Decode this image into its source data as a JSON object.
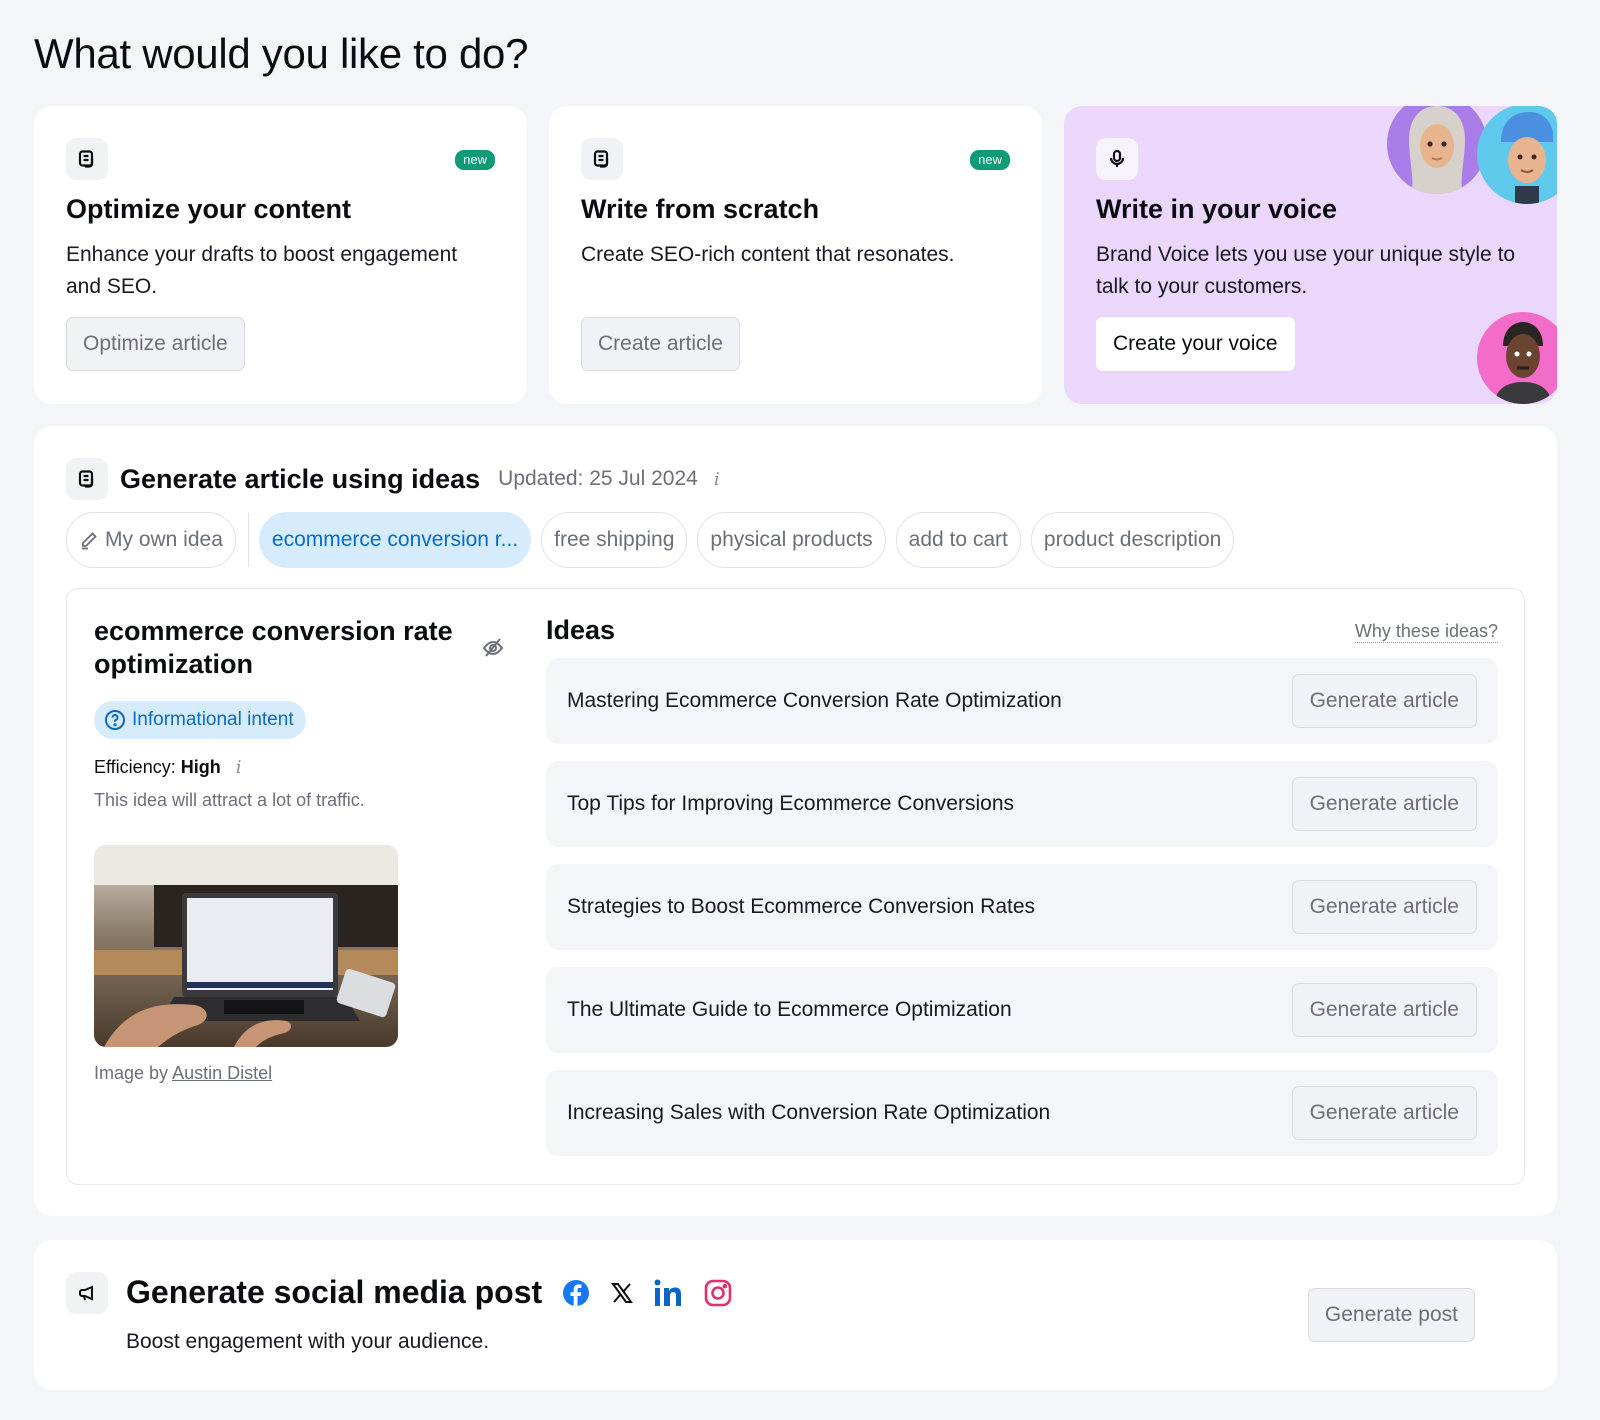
{
  "page": {
    "title": "What would you like to do?"
  },
  "cards": [
    {
      "title": "Optimize your content",
      "description": "Enhance your drafts to boost engagement and SEO.",
      "badge": "new",
      "button": "Optimize article",
      "icon": "document-icon"
    },
    {
      "title": "Write from scratch",
      "description": "Create SEO-rich content that resonates.",
      "badge": "new",
      "button": "Create article",
      "icon": "document-icon"
    },
    {
      "title": "Write in your voice",
      "description": "Brand Voice lets you use your unique style to talk to your customers.",
      "button": "Create your voice",
      "icon": "microphone-icon",
      "background": "#ead7fb"
    }
  ],
  "ideas_section": {
    "title": "Generate article using ideas",
    "updated": "Updated: 25 Jul 2024",
    "chips": [
      {
        "label": "My own idea",
        "icon": "pencil-icon",
        "active": false
      },
      {
        "label": "ecommerce conversion r...",
        "active": true
      },
      {
        "label": "free shipping",
        "active": false
      },
      {
        "label": "physical products",
        "active": false
      },
      {
        "label": "add to cart",
        "active": false
      },
      {
        "label": "product description",
        "active": false
      }
    ],
    "selected": {
      "title": "ecommerce conversion rate optimization",
      "intent": "Informational intent",
      "efficiency_label": "Efficiency:",
      "efficiency_value": "High",
      "efficiency_desc": "This idea will attract a lot of traffic.",
      "image_credit_prefix": "Image by",
      "image_credit_author": "Austin Distel"
    },
    "ideas_label": "Ideas",
    "why_link": "Why these ideas?",
    "ideas": [
      {
        "text": "Mastering Ecommerce Conversion Rate Optimization",
        "button": "Generate article"
      },
      {
        "text": "Top Tips for Improving Ecommerce Conversions",
        "button": "Generate article"
      },
      {
        "text": "Strategies to Boost Ecommerce Conversion Rates",
        "button": "Generate article"
      },
      {
        "text": "The Ultimate Guide to Ecommerce Optimization",
        "button": "Generate article"
      },
      {
        "text": "Increasing Sales with Conversion Rate Optimization",
        "button": "Generate article"
      }
    ]
  },
  "social_section": {
    "title": "Generate social media post",
    "description": "Boost engagement with your audience.",
    "button": "Generate post",
    "platforms": [
      "facebook",
      "x",
      "linkedin",
      "instagram"
    ]
  },
  "colors": {
    "accent_green": "#0f9b77",
    "accent_blue": "#0b6bc2",
    "chip_active_bg": "#d6ecfd",
    "voice_card_bg": "#ead7fb",
    "facebook": "#1877f2",
    "linkedin": "#0a66c2",
    "instagram": "#e1306c"
  }
}
